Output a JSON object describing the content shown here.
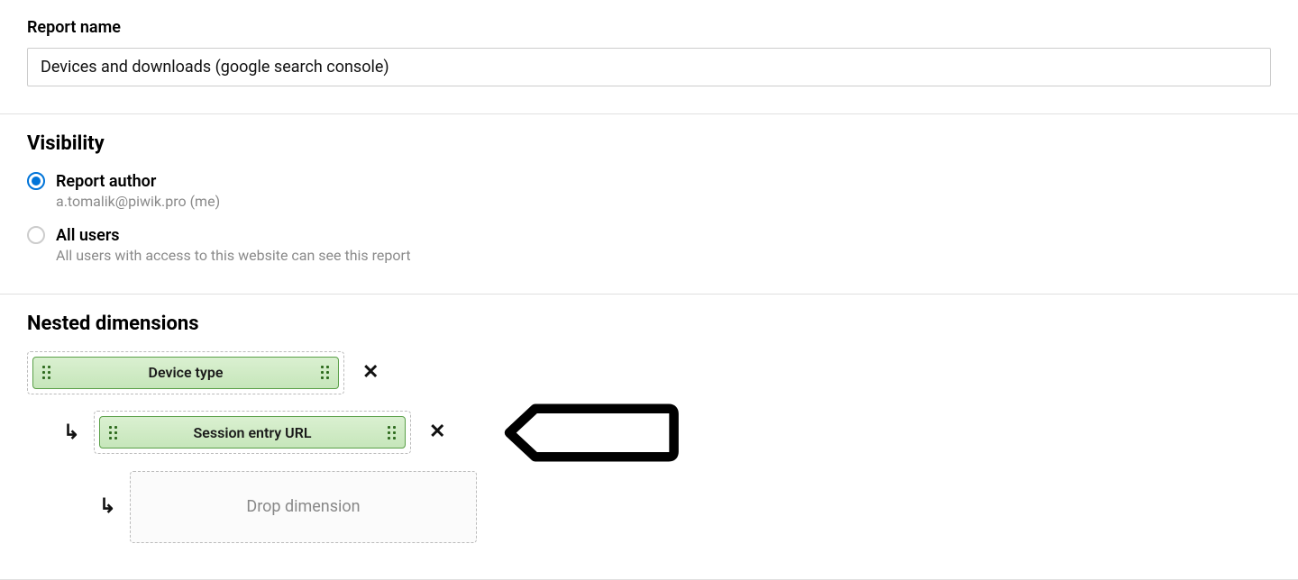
{
  "report": {
    "name_label": "Report name",
    "name_value": "Devices and downloads (google search console)"
  },
  "visibility": {
    "heading": "Visibility",
    "options": [
      {
        "title": "Report author",
        "sub": "a.tomalik@piwik.pro (me)",
        "selected": true
      },
      {
        "title": "All users",
        "sub": "All users with access to this website can see this report",
        "selected": false
      }
    ]
  },
  "nested": {
    "heading": "Nested dimensions",
    "level1": "Device type",
    "level2": "Session entry URL",
    "drop_placeholder": "Drop dimension"
  }
}
